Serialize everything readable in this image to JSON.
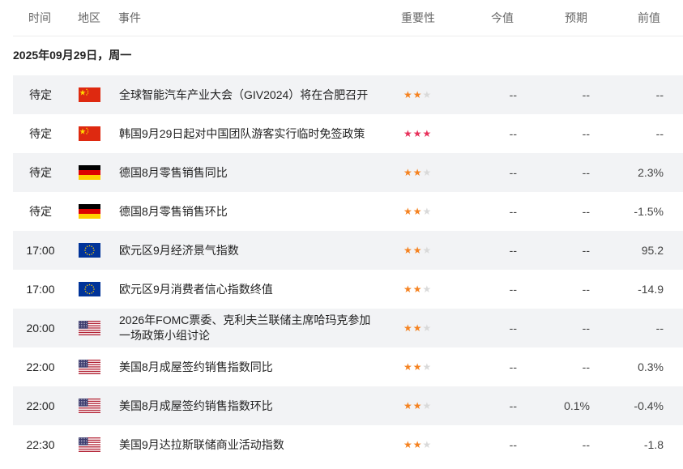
{
  "columns": {
    "time": "时间",
    "region": "地区",
    "event": "事件",
    "importance": "重要性",
    "actual": "今值",
    "forecast": "预期",
    "previous": "前值"
  },
  "date_label": "2025年09月29日，周一",
  "colors": {
    "star_orange": "#f58220",
    "star_red": "#e8315b",
    "star_gray": "#d9d9d9"
  },
  "events": [
    {
      "time": "待定",
      "flag": "china-flag-icon",
      "event": "全球智能汽车产业大会（GIV2024）将在合肥召开",
      "stars": 2,
      "high": false,
      "actual": "--",
      "forecast": "--",
      "previous": "--"
    },
    {
      "time": "待定",
      "flag": "china-flag-icon",
      "event": "韩国9月29日起对中国团队游客实行临时免签政策",
      "stars": 3,
      "high": true,
      "actual": "--",
      "forecast": "--",
      "previous": "--"
    },
    {
      "time": "待定",
      "flag": "germany-flag-icon",
      "event": "德国8月零售销售同比",
      "stars": 2,
      "high": false,
      "actual": "--",
      "forecast": "--",
      "previous": "2.3%"
    },
    {
      "time": "待定",
      "flag": "germany-flag-icon",
      "event": "德国8月零售销售环比",
      "stars": 2,
      "high": false,
      "actual": "--",
      "forecast": "--",
      "previous": "-1.5%"
    },
    {
      "time": "17:00",
      "flag": "eu-flag-icon",
      "event": "欧元区9月经济景气指数",
      "stars": 2,
      "high": false,
      "actual": "--",
      "forecast": "--",
      "previous": "95.2"
    },
    {
      "time": "17:00",
      "flag": "eu-flag-icon",
      "event": "欧元区9月消费者信心指数终值",
      "stars": 2,
      "high": false,
      "actual": "--",
      "forecast": "--",
      "previous": "-14.9"
    },
    {
      "time": "20:00",
      "flag": "us-flag-icon",
      "event": "2026年FOMC票委、克利夫兰联储主席哈玛克参加一场政策小组讨论",
      "stars": 2,
      "high": false,
      "actual": "--",
      "forecast": "--",
      "previous": "--"
    },
    {
      "time": "22:00",
      "flag": "us-flag-icon",
      "event": "美国8月成屋签约销售指数同比",
      "stars": 2,
      "high": false,
      "actual": "--",
      "forecast": "--",
      "previous": "0.3%"
    },
    {
      "time": "22:00",
      "flag": "us-flag-icon",
      "event": "美国8月成屋签约销售指数环比",
      "stars": 2,
      "high": false,
      "actual": "--",
      "forecast": "0.1%",
      "previous": "-0.4%"
    },
    {
      "time": "22:30",
      "flag": "us-flag-icon",
      "event": "美国9月达拉斯联储商业活动指数",
      "stars": 2,
      "high": false,
      "actual": "--",
      "forecast": "--",
      "previous": "-1.8"
    }
  ]
}
